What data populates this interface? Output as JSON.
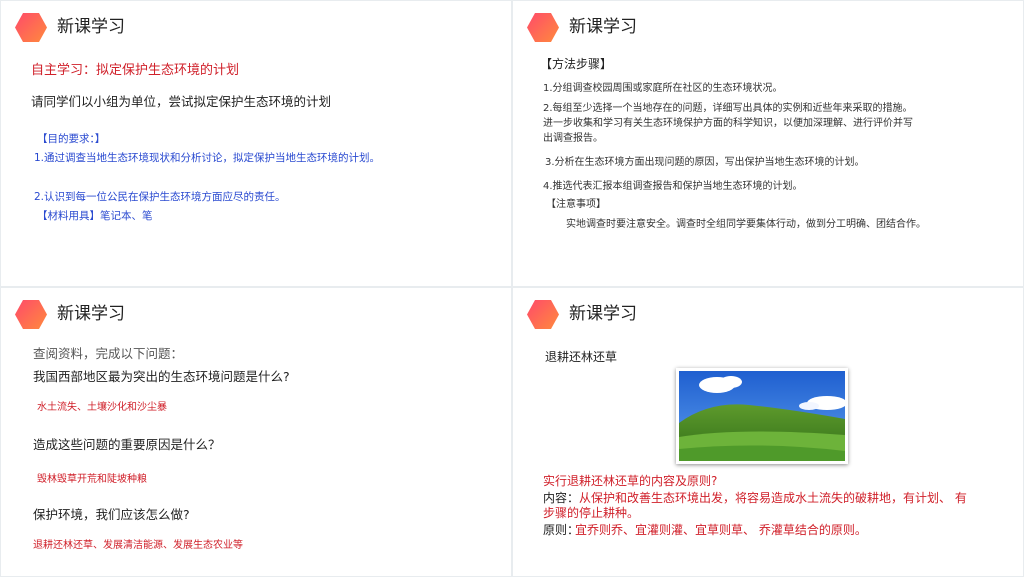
{
  "slides": [
    {
      "title": "新课学习",
      "heading": "自主学习：拟定保护生态环境的计划",
      "intro": "请同学们以小组为单位，尝试拟定保护生态环境的计划",
      "goal_label": "【目的要求：】",
      "goal_1": "1.通过调查当地生态环境现状和分析讨论，拟定保护当地生态环境的计划。",
      "goal_2": "2.认识到每一位公民在保护生态环境方面应尽的责任。",
      "materials": "【材料用具】笔记本、笔"
    },
    {
      "title": "新课学习",
      "heading": "【方法步骤】",
      "step_1": "1.分组调查校园周围或家庭所在社区的生态环境状况。",
      "step_2a": "2.每组至少选择一个当地存在的问题，详细写出具体的实例和近些年来采取的措施。",
      "step_2b": "进一步收集和学习有关生态环境保护方面的科学知识，以便加深理解、进行评价并写",
      "step_2c": "出调查报告。",
      "step_3": "3.分析在生态环境方面出现问题的原因，写出保护当地生态环境的计划。",
      "step_4": "4.推选代表汇报本组调查报告和保护当地生态环境的计划。",
      "note_label": "【注意事项】",
      "note_text": "实地调查时要注意安全。调查时全组同学要集体行动，做到分工明确、团结合作。"
    },
    {
      "title": "新课学习",
      "intro": "查阅资料，完成以下问题：",
      "q1": "我国西部地区最为突出的生态环境问题是什么?",
      "a1": "水土流失、土壤沙化和沙尘暴",
      "q2": "造成这些问题的重要原因是什么？",
      "a2": "毁林毁草开荒和陡坡种粮",
      "q3": "保护环境，我们应该怎么做?",
      "a3": "退耕还林还草、发展清洁能源、发展生态农业等"
    },
    {
      "title": "新课学习",
      "heading": "退耕还林还草",
      "question": "实行退耕还林还草的内容及原则?",
      "content_label": "内容：",
      "content_1": "从保护和改善生态环境出发，将容易造成水土流失的破耕地，有计划、 有",
      "content_2": "步骤的停止耕种。",
      "principle_label": "原则：",
      "principle": "宜乔则乔、宜灌则灌、宜草则草、 乔灌草结合的原则。"
    }
  ]
}
